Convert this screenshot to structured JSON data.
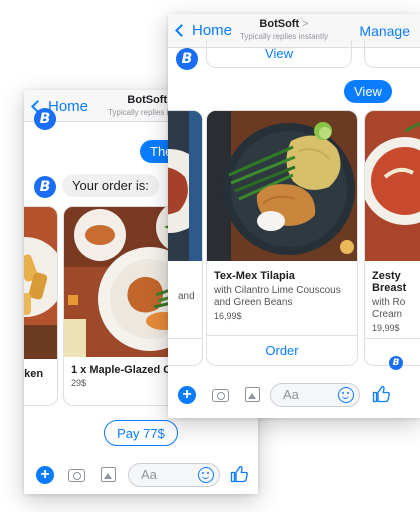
{
  "back_screen": {
    "header": {
      "back_label": "Home",
      "title": "BotSoft",
      "subtitle": "Typically replies instantly"
    },
    "user_message": "The",
    "bot_message": "Your order is:",
    "cards": [
      {
        "title": "cken",
        "price": ""
      },
      {
        "title": "1 x Maple-Glazed Chicken",
        "price": "29$"
      }
    ],
    "pay_button": "Pay 77$",
    "composer": {
      "placeholder": "Aa"
    }
  },
  "front_screen": {
    "header": {
      "back_label": "Home",
      "title": "BotSoft",
      "subtitle": "Typically replies instantly",
      "manage_label": "Manage"
    },
    "view_buttons": [
      "View",
      "View"
    ],
    "cards": [
      {
        "title": "",
        "subtitle": "and",
        "price": ""
      },
      {
        "title": "Tex-Mex Tilapia",
        "subtitle": "with Cilantro Lime Couscous and Green Beans",
        "price": "16,99$",
        "button": "Order"
      },
      {
        "title": "Zesty Breast",
        "subtitle": "with Ro Cream",
        "price": "19,99$"
      }
    ],
    "composer": {
      "placeholder": "Aa"
    }
  },
  "colors": {
    "accent": "#0a7cff",
    "bot_avatar": "#1a6ef5",
    "bubble_gray": "#f1f0f0"
  },
  "icons": [
    "chevron-left-icon",
    "bot-logo-icon",
    "plus-icon",
    "camera-icon",
    "gallery-icon",
    "emoji-icon",
    "thumbs-up-icon"
  ]
}
